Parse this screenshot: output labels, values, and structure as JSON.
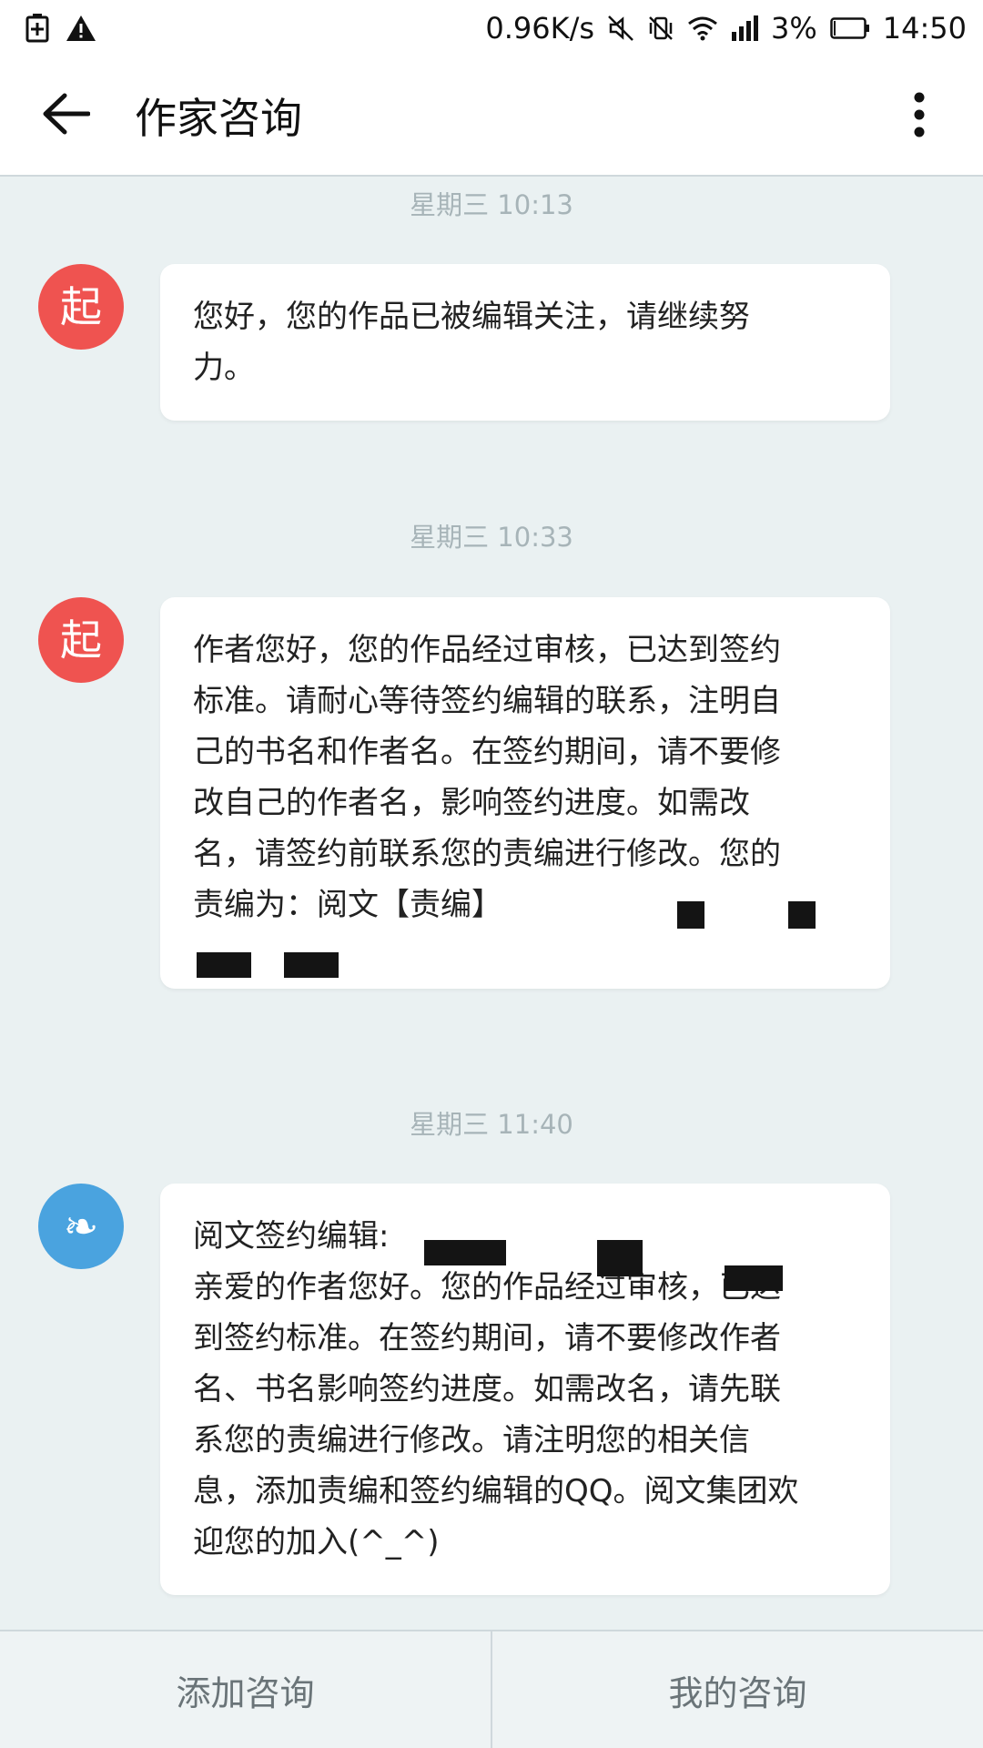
{
  "status_bar": {
    "network_speed": "0.96K/s",
    "battery_percent": "3%",
    "time": "14:50",
    "icons": [
      "battery-saver-icon",
      "warning-icon",
      "mute-icon",
      "vibrate-off-icon",
      "wifi-icon",
      "signal-icon",
      "battery-icon"
    ]
  },
  "header": {
    "title": "作家咨询",
    "back_icon": "arrow-left-icon",
    "more_icon": "more-vertical-icon"
  },
  "messages": [
    {
      "timestamp": "星期三 10:13",
      "avatar_glyph": "起",
      "avatar_color": "#ef5350",
      "text": "您好，您的作品已被编辑关注，请继续努\n力。"
    },
    {
      "timestamp": "星期三 10:33",
      "avatar_glyph": "起",
      "avatar_color": "#ef5350",
      "text": "作者您好，您的作品经过审核，已达到签约\n标准。请耐心等待签约编辑的联系，注明自\n己的书名和作者名。在签约期间，请不要修\n改自己的作者名，影响签约进度。如需改\n名，请签约前联系您的责编进行修改。您的\n责编为：阅文【责编】\n\n"
    },
    {
      "timestamp": "星期三 11:40",
      "avatar_glyph": "❧",
      "avatar_color": "#4aa3df",
      "text": "阅文签约编辑:\n亲爱的作者您好。您的作品经过审核，已达\n到签约标准。在签约期间，请不要修改作者\n名、书名影响签约进度。如需改名，请先联\n系您的责编进行修改。请注明您的相关信\n息，添加责编和签约编辑的QQ。阅文集团欢\n迎您的加入(^_^)"
    }
  ],
  "bottom_bar": {
    "add_label": "添加咨询",
    "mine_label": "我的咨询"
  }
}
